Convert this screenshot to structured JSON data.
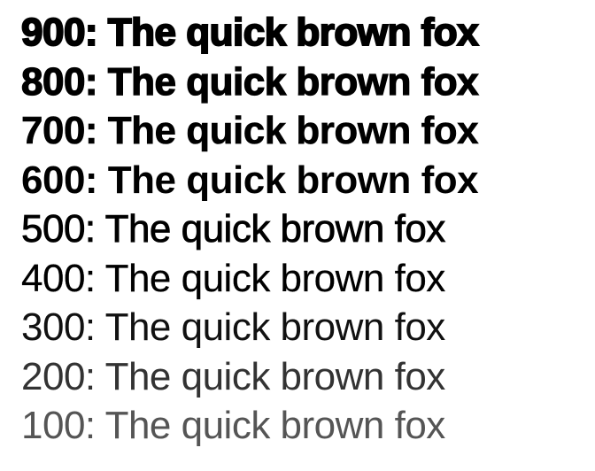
{
  "samples": [
    {
      "weight": "900",
      "text": "900: The quick brown fox"
    },
    {
      "weight": "800",
      "text": "800: The quick brown fox"
    },
    {
      "weight": "700",
      "text": "700: The quick brown fox"
    },
    {
      "weight": "600",
      "text": "600: The quick brown fox"
    },
    {
      "weight": "500",
      "text": "500: The quick brown fox"
    },
    {
      "weight": "400",
      "text": "400: The quick brown fox"
    },
    {
      "weight": "300",
      "text": "300: The quick brown fox"
    },
    {
      "weight": "200",
      "text": "200: The quick brown fox"
    },
    {
      "weight": "100",
      "text": "100: The quick brown fox"
    }
  ]
}
